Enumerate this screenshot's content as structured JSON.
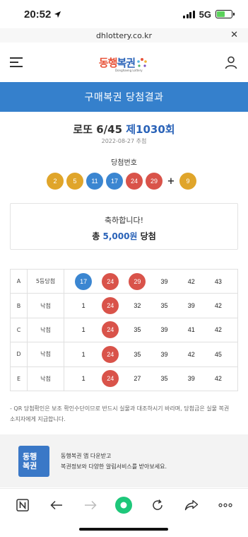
{
  "status_bar": {
    "time": "20:52",
    "network": "5G",
    "battery_level": 0.55
  },
  "browser": {
    "url": "dhlottery.co.kr",
    "close_icon": "close-icon"
  },
  "header": {
    "logo_text_part1": "동행",
    "logo_text_part2": "복권",
    "logo_sub": "Donghaeng Lottery",
    "menu_icon": "hamburger-icon",
    "user_icon": "user-icon"
  },
  "banner": {
    "title": "구매복권 당첨결과"
  },
  "game": {
    "name": "로또 6/45",
    "round": "제1030회",
    "draw_date": "2022-08-27 추첨"
  },
  "winning": {
    "label": "당첨번호",
    "numbers": [
      "2",
      "5",
      "11",
      "17",
      "24",
      "29"
    ],
    "plus": "+",
    "bonus": "9"
  },
  "result": {
    "congrats": "축하합니다!",
    "prize_prefix": "총",
    "prize_amount": "5,000원",
    "prize_suffix": "당첨"
  },
  "ticket": {
    "rows": [
      {
        "letter": "A",
        "status": "5등당첨",
        "numbers": [
          "17",
          "24",
          "29",
          "39",
          "42",
          "43"
        ]
      },
      {
        "letter": "B",
        "status": "낙첨",
        "numbers": [
          "1",
          "24",
          "32",
          "35",
          "39",
          "42"
        ]
      },
      {
        "letter": "C",
        "status": "낙첨",
        "numbers": [
          "1",
          "24",
          "35",
          "39",
          "41",
          "42"
        ]
      },
      {
        "letter": "D",
        "status": "낙첨",
        "numbers": [
          "1",
          "24",
          "35",
          "39",
          "42",
          "45"
        ]
      },
      {
        "letter": "E",
        "status": "낙첨",
        "numbers": [
          "1",
          "24",
          "27",
          "35",
          "39",
          "42"
        ]
      }
    ]
  },
  "notice": {
    "line1": "- QR 당첨확인은 보조 확인수단이므로 반드시 실물과 대조하시기 바라며, 당첨금은 실물 복권",
    "line2": "소지자에게 지급합니다."
  },
  "app_promo": {
    "icon_line1": "동행",
    "icon_line2": "복권",
    "line1": "동행복권 앱 다운받고",
    "line2": "복권정보와 다양한 알림서비스를 받아보세요."
  },
  "colors": {
    "ball_yellow": "#e0a52a",
    "ball_blue": "#3b86d1",
    "ball_red": "#d9534a",
    "accent": "#3580cc"
  },
  "toolbar": {
    "items": [
      "naver-n-icon",
      "back-arrow-icon",
      "forward-arrow-icon",
      "home-green-icon",
      "refresh-icon",
      "share-icon",
      "more-icon"
    ]
  }
}
